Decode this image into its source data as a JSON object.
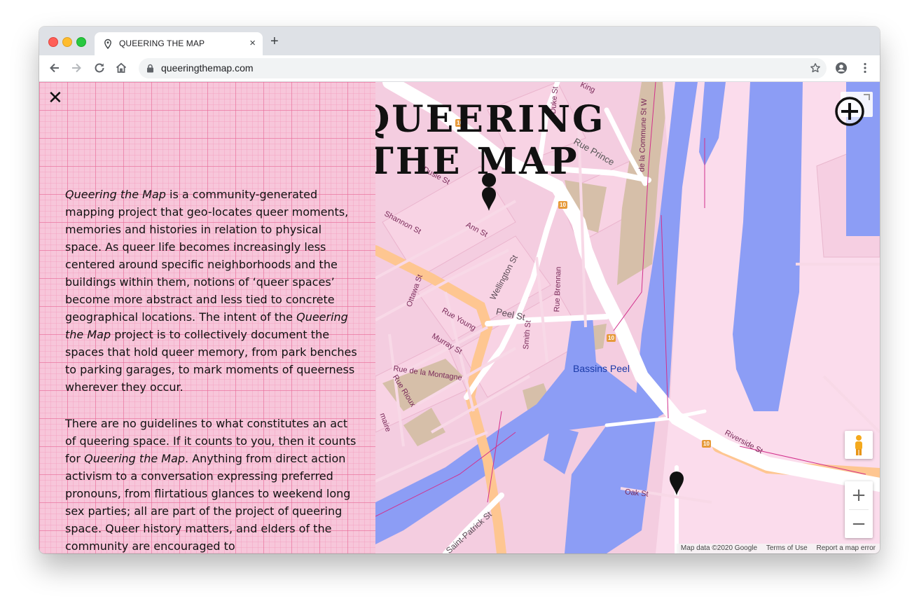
{
  "browser": {
    "tab_title": "QUEERING THE MAP",
    "new_tab": "+",
    "tab_close": "×",
    "url": "queeringthemap.com"
  },
  "panel": {
    "close_label": "✕",
    "p1": {
      "a_it": "Queering the Map",
      "b": " is a community-generated mapping project that geo-locates queer moments, memories and histories in relation to physical space. As queer life becomes increasingly less centered around specific neighborhoods and the buildings within them, notions of ‘queer spaces’ become more abstract and less tied to concrete geographical locations. The intent of the ",
      "c_it": "Queering the Map",
      "d": " project is to collectively document the spaces that hold queer memory, from park benches to parking garages, to mark moments of queerness wherever they occur."
    },
    "p2": {
      "a": "There are no guidelines to what constitutes an act of queering space. If it counts to you, then it counts for ",
      "b_it": "Queering the Map",
      "c": ". Anything from direct action activism to a conversation expressing preferred pronouns, from flirtatious glances to weekend long sex parties; all are part of the project of queering space. Queer history matters, and elders of the community are encouraged to"
    }
  },
  "map": {
    "logo_line1": "QUEERING",
    "logo_line2": "THE MAP",
    "zoom_in": "+",
    "zoom_out": "−",
    "attribution": {
      "data": "Map data ©2020 Google",
      "terms": "Terms of Use",
      "report": "Report a map error"
    },
    "labels": {
      "rue_prince": "Rue Prince",
      "shannon": "Shannon St",
      "ann": "Ann St",
      "wellington": "Wellington St",
      "peel": "Peel St",
      "ottawa": "Ottawa St",
      "rue_young": "Rue Young",
      "murray": "Murray St",
      "rue_montagne": "Rue de la Montagne",
      "rue_riou": "Rue Rioux",
      "smith": "Smith St",
      "rue_brennan": "Rue Brennan",
      "bassins": "Bassins Peel",
      "riverside": "Riverside St",
      "oak": "Oak St",
      "saint_patrick": "Saint-Patrick St",
      "king": "King",
      "dusie": "Dusie St",
      "commune": "de la Commune St W",
      "duke": "Duke St",
      "maire": "maire",
      "route": "10"
    },
    "colors": {
      "land": "#f4cde0",
      "water": "#8c9df5",
      "road": "#ffffff",
      "highway": "#fec691",
      "park": "#d6bfa9"
    }
  }
}
